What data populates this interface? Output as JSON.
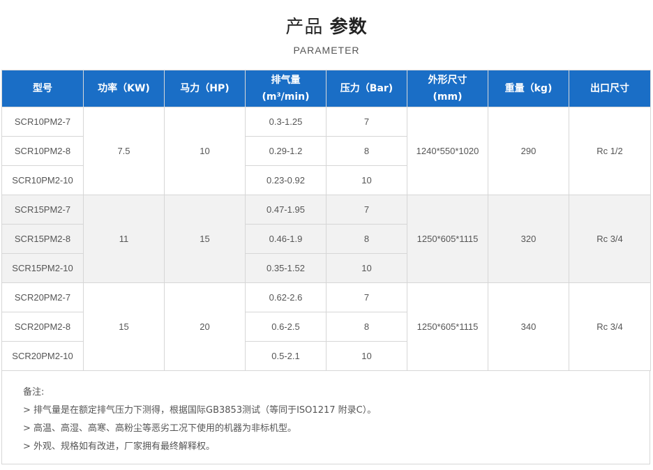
{
  "header": {
    "title_part1": "产品",
    "title_part2": "参数",
    "subtitle": "PARAMETER"
  },
  "table": {
    "columns": [
      {
        "line1": "型号",
        "line2": ""
      },
      {
        "line1": "功率（KW)",
        "line2": ""
      },
      {
        "line1": "马力（HP)",
        "line2": ""
      },
      {
        "line1": "排气量",
        "line2": "(m³/min)"
      },
      {
        "line1": "压力（Bar)",
        "line2": ""
      },
      {
        "line1": "外形尺寸",
        "line2": "(mm)"
      },
      {
        "line1": "重量（kg)",
        "line2": ""
      },
      {
        "line1": "出口尺寸",
        "line2": ""
      }
    ],
    "groups": [
      {
        "power": "7.5",
        "hp": "10",
        "dims": "1240*550*1020",
        "weight": "290",
        "outlet": "Rc 1/2",
        "rows": [
          {
            "model": "SCR10PM2-7",
            "flow": "0.3-1.25",
            "pressure": "7"
          },
          {
            "model": "SCR10PM2-8",
            "flow": "0.29-1.2",
            "pressure": "8"
          },
          {
            "model": "SCR10PM2-10",
            "flow": "0.23-0.92",
            "pressure": "10"
          }
        ]
      },
      {
        "power": "11",
        "hp": "15",
        "dims": "1250*605*1115",
        "weight": "320",
        "outlet": "Rc 3/4",
        "rows": [
          {
            "model": "SCR15PM2-7",
            "flow": "0.47-1.95",
            "pressure": "7"
          },
          {
            "model": "SCR15PM2-8",
            "flow": "0.46-1.9",
            "pressure": "8"
          },
          {
            "model": "SCR15PM2-10",
            "flow": "0.35-1.52",
            "pressure": "10"
          }
        ]
      },
      {
        "power": "15",
        "hp": "20",
        "dims": "1250*605*1115",
        "weight": "340",
        "outlet": "Rc 3/4",
        "rows": [
          {
            "model": "SCR20PM2-7",
            "flow": "0.62-2.6",
            "pressure": "7"
          },
          {
            "model": "SCR20PM2-8",
            "flow": "0.6-2.5",
            "pressure": "8"
          },
          {
            "model": "SCR20PM2-10",
            "flow": "0.5-2.1",
            "pressure": "10"
          }
        ]
      }
    ]
  },
  "notes": {
    "title": "备注:",
    "lines": [
      "> 排气量是在额定排气压力下测得，根据国际GB3853测试（等同于ISO1217 附录C）。",
      "> 高温、高湿、高寒、高粉尘等恶劣工况下使用的机器为非标机型。",
      "> 外观、规格如有改进，厂家拥有最终解释权。"
    ]
  }
}
